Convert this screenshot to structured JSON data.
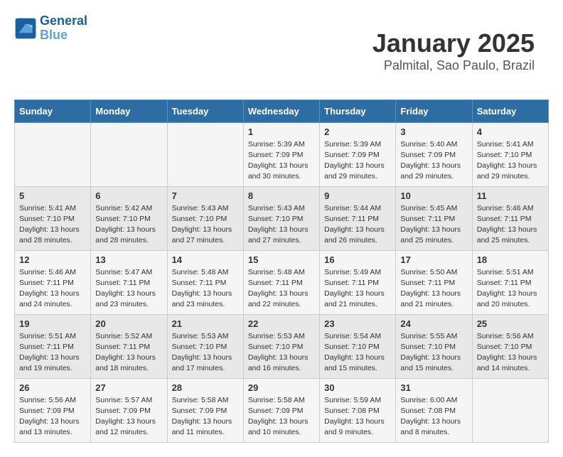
{
  "logo": {
    "line1": "General",
    "line2": "Blue"
  },
  "title": "January 2025",
  "subtitle": "Palmital, Sao Paulo, Brazil",
  "weekdays": [
    "Sunday",
    "Monday",
    "Tuesday",
    "Wednesday",
    "Thursday",
    "Friday",
    "Saturday"
  ],
  "weeks": [
    [
      {
        "day": "",
        "info": ""
      },
      {
        "day": "",
        "info": ""
      },
      {
        "day": "",
        "info": ""
      },
      {
        "day": "1",
        "info": "Sunrise: 5:39 AM\nSunset: 7:09 PM\nDaylight: 13 hours\nand 30 minutes."
      },
      {
        "day": "2",
        "info": "Sunrise: 5:39 AM\nSunset: 7:09 PM\nDaylight: 13 hours\nand 29 minutes."
      },
      {
        "day": "3",
        "info": "Sunrise: 5:40 AM\nSunset: 7:09 PM\nDaylight: 13 hours\nand 29 minutes."
      },
      {
        "day": "4",
        "info": "Sunrise: 5:41 AM\nSunset: 7:10 PM\nDaylight: 13 hours\nand 29 minutes."
      }
    ],
    [
      {
        "day": "5",
        "info": "Sunrise: 5:41 AM\nSunset: 7:10 PM\nDaylight: 13 hours\nand 28 minutes."
      },
      {
        "day": "6",
        "info": "Sunrise: 5:42 AM\nSunset: 7:10 PM\nDaylight: 13 hours\nand 28 minutes."
      },
      {
        "day": "7",
        "info": "Sunrise: 5:43 AM\nSunset: 7:10 PM\nDaylight: 13 hours\nand 27 minutes."
      },
      {
        "day": "8",
        "info": "Sunrise: 5:43 AM\nSunset: 7:10 PM\nDaylight: 13 hours\nand 27 minutes."
      },
      {
        "day": "9",
        "info": "Sunrise: 5:44 AM\nSunset: 7:11 PM\nDaylight: 13 hours\nand 26 minutes."
      },
      {
        "day": "10",
        "info": "Sunrise: 5:45 AM\nSunset: 7:11 PM\nDaylight: 13 hours\nand 25 minutes."
      },
      {
        "day": "11",
        "info": "Sunrise: 5:46 AM\nSunset: 7:11 PM\nDaylight: 13 hours\nand 25 minutes."
      }
    ],
    [
      {
        "day": "12",
        "info": "Sunrise: 5:46 AM\nSunset: 7:11 PM\nDaylight: 13 hours\nand 24 minutes."
      },
      {
        "day": "13",
        "info": "Sunrise: 5:47 AM\nSunset: 7:11 PM\nDaylight: 13 hours\nand 23 minutes."
      },
      {
        "day": "14",
        "info": "Sunrise: 5:48 AM\nSunset: 7:11 PM\nDaylight: 13 hours\nand 23 minutes."
      },
      {
        "day": "15",
        "info": "Sunrise: 5:48 AM\nSunset: 7:11 PM\nDaylight: 13 hours\nand 22 minutes."
      },
      {
        "day": "16",
        "info": "Sunrise: 5:49 AM\nSunset: 7:11 PM\nDaylight: 13 hours\nand 21 minutes."
      },
      {
        "day": "17",
        "info": "Sunrise: 5:50 AM\nSunset: 7:11 PM\nDaylight: 13 hours\nand 21 minutes."
      },
      {
        "day": "18",
        "info": "Sunrise: 5:51 AM\nSunset: 7:11 PM\nDaylight: 13 hours\nand 20 minutes."
      }
    ],
    [
      {
        "day": "19",
        "info": "Sunrise: 5:51 AM\nSunset: 7:11 PM\nDaylight: 13 hours\nand 19 minutes."
      },
      {
        "day": "20",
        "info": "Sunrise: 5:52 AM\nSunset: 7:11 PM\nDaylight: 13 hours\nand 18 minutes."
      },
      {
        "day": "21",
        "info": "Sunrise: 5:53 AM\nSunset: 7:10 PM\nDaylight: 13 hours\nand 17 minutes."
      },
      {
        "day": "22",
        "info": "Sunrise: 5:53 AM\nSunset: 7:10 PM\nDaylight: 13 hours\nand 16 minutes."
      },
      {
        "day": "23",
        "info": "Sunrise: 5:54 AM\nSunset: 7:10 PM\nDaylight: 13 hours\nand 15 minutes."
      },
      {
        "day": "24",
        "info": "Sunrise: 5:55 AM\nSunset: 7:10 PM\nDaylight: 13 hours\nand 15 minutes."
      },
      {
        "day": "25",
        "info": "Sunrise: 5:56 AM\nSunset: 7:10 PM\nDaylight: 13 hours\nand 14 minutes."
      }
    ],
    [
      {
        "day": "26",
        "info": "Sunrise: 5:56 AM\nSunset: 7:09 PM\nDaylight: 13 hours\nand 13 minutes."
      },
      {
        "day": "27",
        "info": "Sunrise: 5:57 AM\nSunset: 7:09 PM\nDaylight: 13 hours\nand 12 minutes."
      },
      {
        "day": "28",
        "info": "Sunrise: 5:58 AM\nSunset: 7:09 PM\nDaylight: 13 hours\nand 11 minutes."
      },
      {
        "day": "29",
        "info": "Sunrise: 5:58 AM\nSunset: 7:09 PM\nDaylight: 13 hours\nand 10 minutes."
      },
      {
        "day": "30",
        "info": "Sunrise: 5:59 AM\nSunset: 7:08 PM\nDaylight: 13 hours\nand 9 minutes."
      },
      {
        "day": "31",
        "info": "Sunrise: 6:00 AM\nSunset: 7:08 PM\nDaylight: 13 hours\nand 8 minutes."
      },
      {
        "day": "",
        "info": ""
      }
    ]
  ]
}
